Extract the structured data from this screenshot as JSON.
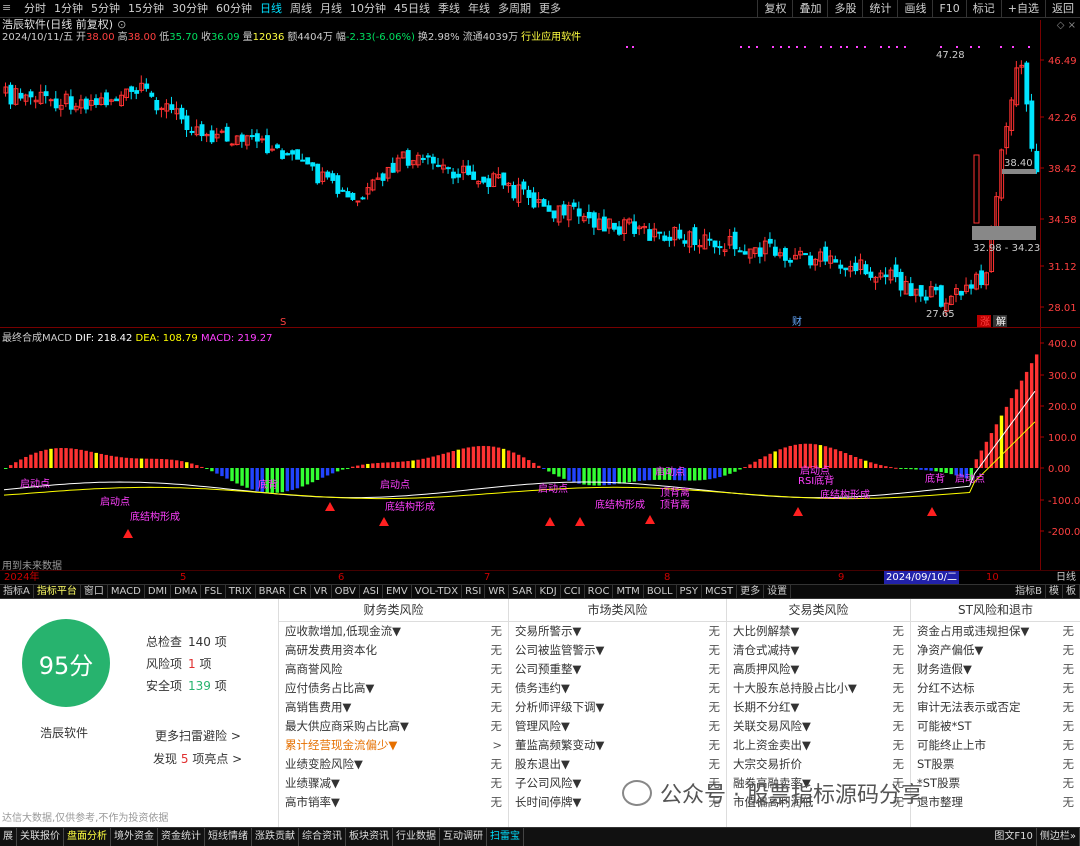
{
  "timeframes": [
    "分时",
    "1分钟",
    "5分钟",
    "15分钟",
    "30分钟",
    "60分钟",
    "日线",
    "周线",
    "月线",
    "10分钟",
    "45日线",
    "季线",
    "年线",
    "多周期",
    "更多"
  ],
  "timeframes_active": 6,
  "topbar_right": [
    "复权",
    "叠加",
    "多股",
    "统计",
    "画线",
    "F10",
    "标记",
    "+自选",
    "返回"
  ],
  "chart_title": "浩辰软件(日线 前复权)",
  "quote": {
    "date": "2024/10/11/五",
    "open_label": "开",
    "open": "38.00",
    "high_label": "高",
    "high": "38.00",
    "low_label": "低",
    "low": "35.70",
    "close_label": "收",
    "close": "36.09",
    "vol_label": "量",
    "vol": "12036",
    "amt_label": "额",
    "amt": "4404万",
    "chg_label": "幅",
    "chg": "-2.33(-6.06%)",
    "turn_label": "换",
    "turn": "2.98%",
    "float_label": "流通",
    "float": "4039万",
    "industry": "行业应用软件"
  },
  "price_axis": [
    "46.49",
    "42.26",
    "38.42",
    "34.58",
    "31.12",
    "28.01"
  ],
  "price_labels": {
    "high": "47.28",
    "low": "27.65",
    "last": "38.40",
    "range": "32.98 - 34.23"
  },
  "price_markers": {
    "s": "S",
    "fin": "财",
    "up": "涨",
    "jie": "解"
  },
  "macd": {
    "name": "最终合成MACD",
    "dif": "DIF: 218.42",
    "dea": "DEA: 108.79",
    "macd": "MACD: 219.27"
  },
  "macd_axis": [
    "400.0",
    "300.0",
    "200.0",
    "100.0",
    "0.00",
    "-100.0",
    "-200.0"
  ],
  "macd_annotations": [
    "启动点",
    "启动点",
    "底背",
    "底结构形成",
    "启动点",
    "启动点",
    "底结构形成",
    "启动点",
    "顶背离",
    "底结构形成",
    "RSI底背",
    "启动点",
    "底背",
    "启动点",
    "底结构形成",
    "顶背离"
  ],
  "future_note": "用到未来数据",
  "date_axis": [
    "2024年",
    "5",
    "6",
    "7",
    "8",
    "9",
    "2024/09/10/二",
    "10"
  ],
  "date_axis_right": "日线",
  "indicator_tabs": [
    "指标A",
    "指标平台",
    "窗口",
    "MACD",
    "DMI",
    "DMA",
    "FSL",
    "TRIX",
    "BRAR",
    "CR",
    "VR",
    "OBV",
    "ASI",
    "EMV",
    "VOL-TDX",
    "RSI",
    "WR",
    "SAR",
    "KDJ",
    "CCI",
    "ROC",
    "MTM",
    "BOLL",
    "PSY",
    "MCST",
    "更多",
    "设置"
  ],
  "indicator_tabs_right": [
    "指标B",
    "模",
    "板"
  ],
  "risk": {
    "score": "95分",
    "company": "浩辰软件",
    "total_label": "总检查",
    "total": "140",
    "total_unit": "项",
    "risk_label": "风险项",
    "risk": "1",
    "risk_unit": "项",
    "safe_label": "安全项",
    "safe": "139",
    "safe_unit": "项",
    "more": "更多扫雷避险 >",
    "find_pre": "发现",
    "find_num": "5",
    "find_post": "项亮点 >",
    "disclaimer": "达信大数据,仅供参考,不作为投资依据",
    "columns": [
      {
        "title": "财务类风险",
        "rows": [
          [
            "应收款增加,低现金流▼",
            "无"
          ],
          [
            "高研发费用资本化",
            "无"
          ],
          [
            "高商誉风险",
            "无"
          ],
          [
            "应付债务占比高▼",
            "无"
          ],
          [
            "高销售费用▼",
            "无"
          ],
          [
            "最大供应商采购占比高▼",
            "无"
          ],
          [
            "累计经营现金流偏少▼",
            ">"
          ],
          [
            "业绩变脸风险▼",
            "无"
          ],
          [
            "业绩骤减▼",
            "无"
          ],
          [
            "高市销率▼",
            "无"
          ]
        ]
      },
      {
        "title": "市场类风险",
        "rows": [
          [
            "交易所警示▼",
            "无"
          ],
          [
            "公司被监管警示▼",
            "无"
          ],
          [
            "公司预重整▼",
            "无"
          ],
          [
            "债务违约▼",
            "无"
          ],
          [
            "分析师评级下调▼",
            "无"
          ],
          [
            "管理风险▼",
            "无"
          ],
          [
            "董监高频繁变动▼",
            "无"
          ],
          [
            "股东退出▼",
            "无"
          ],
          [
            "子公司风险▼",
            "无"
          ],
          [
            "长时间停牌▼",
            "无"
          ]
        ]
      },
      {
        "title": "交易类风险",
        "rows": [
          [
            "大比例解禁▼",
            "无"
          ],
          [
            "清仓式减持▼",
            "无"
          ],
          [
            "高质押风险▼",
            "无"
          ],
          [
            "十大股东总持股占比小▼",
            "无"
          ],
          [
            "长期不分红▼",
            "无"
          ],
          [
            "关联交易风险▼",
            "无"
          ],
          [
            "北上资金卖出▼",
            "无"
          ],
          [
            "大宗交易折价",
            "无"
          ],
          [
            "融券高融卖率▼",
            "无"
          ],
          [
            "市值偏高利润低",
            "无"
          ]
        ]
      },
      {
        "title": "ST风险和退市",
        "rows": [
          [
            "资金占用或违规担保▼",
            "无"
          ],
          [
            "净资产偏低▼",
            "无"
          ],
          [
            "财务造假▼",
            "无"
          ],
          [
            "分红不达标",
            "无"
          ],
          [
            "审计无法表示或否定",
            "无"
          ],
          [
            "可能被*ST",
            "无"
          ],
          [
            "可能终止上市",
            "无"
          ],
          [
            "ST股票",
            "无"
          ],
          [
            "*ST股票",
            "无"
          ],
          [
            "退市整理",
            "无"
          ]
        ]
      }
    ]
  },
  "watermark": "公众号 · 股票指标源码分享",
  "bottom_tabs": [
    "展",
    "关联报价",
    "盘面分析",
    "境外资金",
    "资金统计",
    "短线情绪",
    "涨跌贡献",
    "综合资讯",
    "板块资讯",
    "行业数据",
    "互动调研",
    "扫雷宝"
  ],
  "bottom_right": [
    "图文F10",
    "侧边栏»"
  ],
  "colors": {
    "up": "#ff3232",
    "down": "#00e5ff",
    "macd_green": "#33ff33",
    "macd_blue": "#2244ff",
    "macd_yellow": "#ffff00",
    "accent": "#00e0ff",
    "score_bg": "#27b36e",
    "alert": "#e67000"
  }
}
